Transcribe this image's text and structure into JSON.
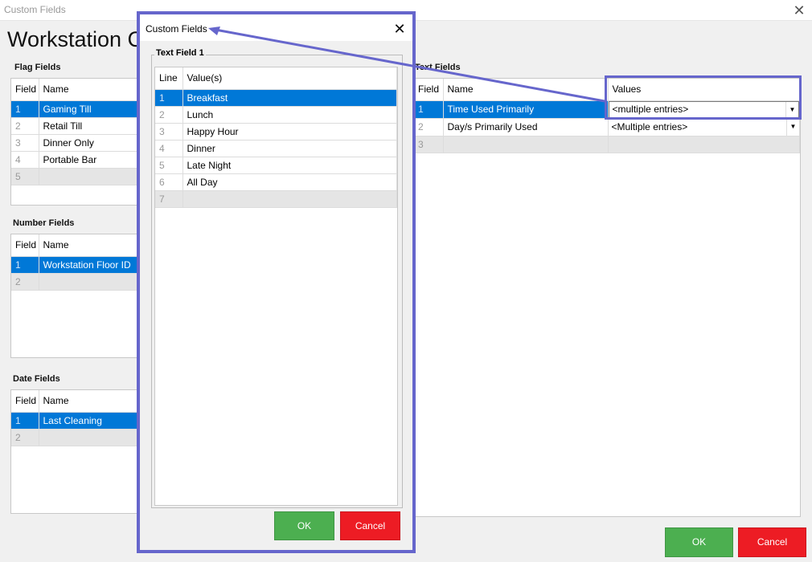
{
  "window": {
    "title": "Custom Fields"
  },
  "page": {
    "title": "Workstation C"
  },
  "flag_fields": {
    "label": "Flag Fields",
    "headers": [
      "Field",
      "Name"
    ],
    "rows": [
      {
        "num": "1",
        "name": "Gaming Till"
      },
      {
        "num": "2",
        "name": "Retail Till"
      },
      {
        "num": "3",
        "name": "Dinner Only"
      },
      {
        "num": "4",
        "name": "Portable Bar"
      },
      {
        "num": "5",
        "name": ""
      }
    ]
  },
  "number_fields": {
    "label": "Number Fields",
    "headers": [
      "Field",
      "Name"
    ],
    "rows": [
      {
        "num": "1",
        "name": "Workstation Floor ID"
      },
      {
        "num": "2",
        "name": ""
      }
    ]
  },
  "date_fields": {
    "label": "Date Fields",
    "headers": [
      "Field",
      "Name"
    ],
    "rows": [
      {
        "num": "1",
        "name": "Last Cleaning"
      },
      {
        "num": "2",
        "name": ""
      }
    ]
  },
  "text_fields": {
    "label": "Text Fields",
    "headers": [
      "Field",
      "Name",
      "Values"
    ],
    "rows": [
      {
        "num": "1",
        "name": "Time Used Primarily",
        "value": "<multiple entries>"
      },
      {
        "num": "2",
        "name": "Day/s Primarily Used",
        "value": "<Multiple entries>"
      },
      {
        "num": "3",
        "name": "",
        "value": ""
      }
    ]
  },
  "main_buttons": {
    "ok": "OK",
    "cancel": "Cancel"
  },
  "dialog": {
    "title": "Custom Fields",
    "group_label": "Text Field 1",
    "headers": [
      "Line",
      "Value(s)"
    ],
    "rows": [
      {
        "num": "1",
        "value": "Breakfast"
      },
      {
        "num": "2",
        "value": "Lunch"
      },
      {
        "num": "3",
        "value": "Happy Hour"
      },
      {
        "num": "4",
        "value": "Dinner"
      },
      {
        "num": "5",
        "value": "Late Night"
      },
      {
        "num": "6",
        "value": "All Day"
      },
      {
        "num": "7",
        "value": ""
      }
    ],
    "ok": "OK",
    "cancel": "Cancel"
  },
  "colors": {
    "selection": "#0078d7",
    "ok": "#4caf50",
    "cancel": "#ed1c24",
    "annotation": "#6666cc"
  },
  "icons": {
    "close": "close-icon",
    "dropdown": "chevron-down-icon"
  }
}
